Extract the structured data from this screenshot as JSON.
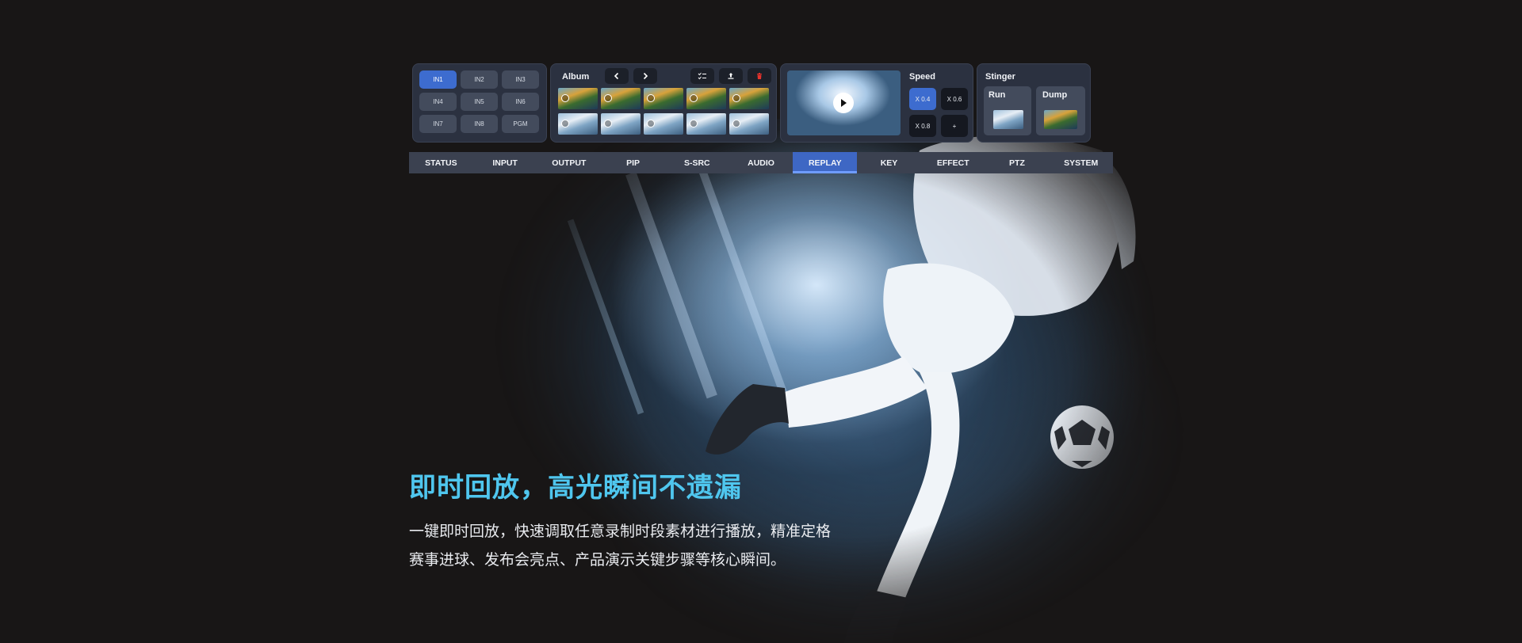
{
  "colors": {
    "accent": "#3d6ccf",
    "headline": "#4fc6ee",
    "background": "#181616",
    "delete": "#e5322c"
  },
  "inputs": {
    "buttons": [
      "IN1",
      "IN2",
      "IN3",
      "IN4",
      "IN5",
      "IN6",
      "IN7",
      "IN8",
      "PGM"
    ],
    "selected": "IN1"
  },
  "album": {
    "title": "Album",
    "icons": [
      "chevron-left-icon",
      "chevron-right-icon",
      "checklist-icon",
      "upload-icon",
      "trash-icon"
    ],
    "thumbnail_count": 10
  },
  "preview": {
    "icon": "play-icon"
  },
  "speed": {
    "title": "Speed",
    "options": [
      "X 0.4",
      "X 0.6",
      "X 0.8",
      "+"
    ],
    "selected": "X 0.4"
  },
  "stinger": {
    "title": "Stinger",
    "run_label": "Run",
    "dump_label": "Dump"
  },
  "tabs": {
    "items": [
      "STATUS",
      "INPUT",
      "OUTPUT",
      "PIP",
      "S-SRC",
      "AUDIO",
      "REPLAY",
      "KEY",
      "EFFECT",
      "PTZ",
      "SYSTEM"
    ],
    "active": "REPLAY"
  },
  "hero": {
    "headline": "即时回放，高光瞬间不遗漏",
    "line1": "一键即时回放，快速调取任意录制时段素材进行播放，精准定格",
    "line2": "赛事进球、发布会亮点、产品演示关键步骤等核心瞬间。"
  }
}
